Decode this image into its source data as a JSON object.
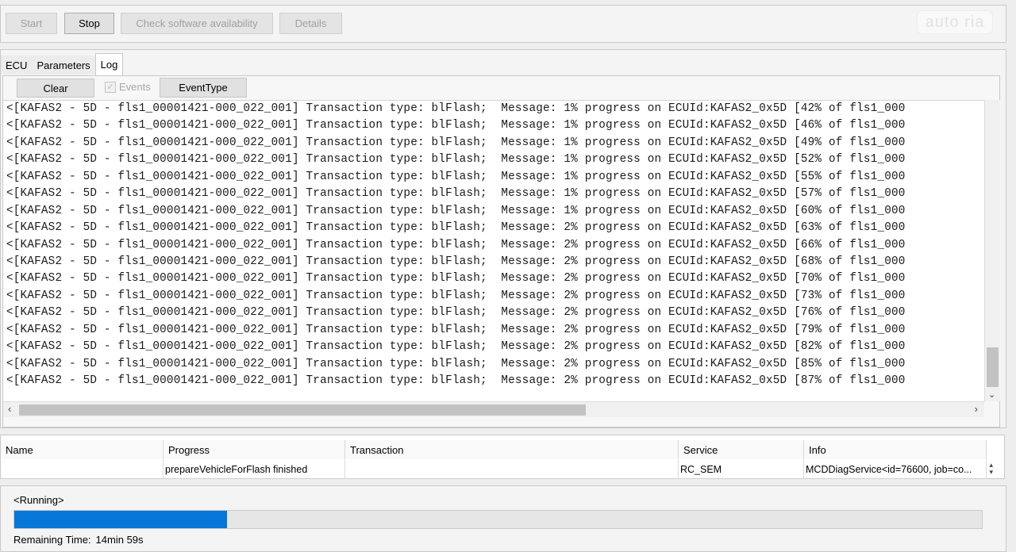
{
  "toolbar": {
    "start_label": "Start",
    "stop_label": "Stop",
    "check_label": "Check software availability",
    "details_label": "Details",
    "watermark_text": "auto ria"
  },
  "tabs": [
    {
      "label": "ECU",
      "active": false
    },
    {
      "label": "Parameters",
      "active": false
    },
    {
      "label": "Log",
      "active": true
    }
  ],
  "log": {
    "clear_label": "Clear",
    "events_label": "Events",
    "events_checked": true,
    "eventtype_label": "EventType",
    "lines": [
      "<[KAFAS2 - 5D - fls1_00001421-000_022_001] Transaction type: blFlash;  Message: 1% progress on ECUId:KAFAS2_0x5D [42% of fls1_000",
      "<[KAFAS2 - 5D - fls1_00001421-000_022_001] Transaction type: blFlash;  Message: 1% progress on ECUId:KAFAS2_0x5D [46% of fls1_000",
      "<[KAFAS2 - 5D - fls1_00001421-000_022_001] Transaction type: blFlash;  Message: 1% progress on ECUId:KAFAS2_0x5D [49% of fls1_000",
      "<[KAFAS2 - 5D - fls1_00001421-000_022_001] Transaction type: blFlash;  Message: 1% progress on ECUId:KAFAS2_0x5D [52% of fls1_000",
      "<[KAFAS2 - 5D - fls1_00001421-000_022_001] Transaction type: blFlash;  Message: 1% progress on ECUId:KAFAS2_0x5D [55% of fls1_000",
      "<[KAFAS2 - 5D - fls1_00001421-000_022_001] Transaction type: blFlash;  Message: 1% progress on ECUId:KAFAS2_0x5D [57% of fls1_000",
      "<[KAFAS2 - 5D - fls1_00001421-000_022_001] Transaction type: blFlash;  Message: 1% progress on ECUId:KAFAS2_0x5D [60% of fls1_000",
      "<[KAFAS2 - 5D - fls1_00001421-000_022_001] Transaction type: blFlash;  Message: 2% progress on ECUId:KAFAS2_0x5D [63% of fls1_000",
      "<[KAFAS2 - 5D - fls1_00001421-000_022_001] Transaction type: blFlash;  Message: 2% progress on ECUId:KAFAS2_0x5D [66% of fls1_000",
      "<[KAFAS2 - 5D - fls1_00001421-000_022_001] Transaction type: blFlash;  Message: 2% progress on ECUId:KAFAS2_0x5D [68% of fls1_000",
      "<[KAFAS2 - 5D - fls1_00001421-000_022_001] Transaction type: blFlash;  Message: 2% progress on ECUId:KAFAS2_0x5D [70% of fls1_000",
      "<[KAFAS2 - 5D - fls1_00001421-000_022_001] Transaction type: blFlash;  Message: 2% progress on ECUId:KAFAS2_0x5D [73% of fls1_000",
      "<[KAFAS2 - 5D - fls1_00001421-000_022_001] Transaction type: blFlash;  Message: 2% progress on ECUId:KAFAS2_0x5D [76% of fls1_000",
      "<[KAFAS2 - 5D - fls1_00001421-000_022_001] Transaction type: blFlash;  Message: 2% progress on ECUId:KAFAS2_0x5D [79% of fls1_000",
      "<[KAFAS2 - 5D - fls1_00001421-000_022_001] Transaction type: blFlash;  Message: 2% progress on ECUId:KAFAS2_0x5D [82% of fls1_000",
      "<[KAFAS2 - 5D - fls1_00001421-000_022_001] Transaction type: blFlash;  Message: 2% progress on ECUId:KAFAS2_0x5D [85% of fls1_000",
      "<[KAFAS2 - 5D - fls1_00001421-000_022_001] Transaction type: blFlash;  Message: 2% progress on ECUId:KAFAS2_0x5D [87% of fls1_000"
    ]
  },
  "table": {
    "headers": [
      "Name",
      "Progress",
      "Transaction",
      "Service",
      "Info"
    ],
    "rows": [
      [
        "",
        "prepareVehicleForFlash finished",
        "",
        "RC_SEM",
        "MCDDiagService<id=76600, job=co..."
      ]
    ]
  },
  "status": {
    "state_text": "<Running>",
    "progress_fraction": 0.22,
    "progress_color": "#0676d8",
    "remaining_label": "Remaining Time:",
    "remaining_value": "14min 59s"
  },
  "icons": {
    "scroll_down": "chevron-down-icon",
    "scroll_left": "chevron-left-icon",
    "scroll_right": "chevron-right-icon",
    "checkbox": "check-icon"
  }
}
